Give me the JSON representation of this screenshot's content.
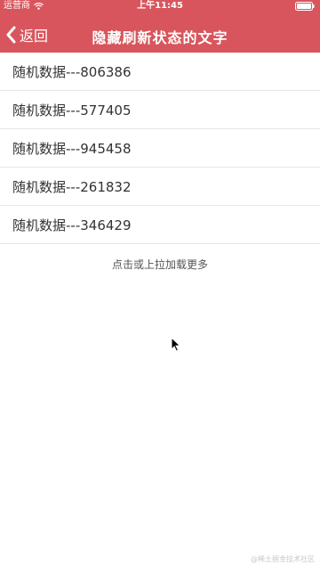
{
  "status_bar": {
    "carrier": "运营商",
    "time": "上午11:45",
    "wifi_icon": "wifi-icon",
    "battery_icon": "battery-icon"
  },
  "nav": {
    "back_label": "返回",
    "back_icon": "chevron-left-icon",
    "title": "隐藏刷新状态的文字",
    "color": "#d9555d"
  },
  "list": {
    "items": [
      {
        "label": "随机数据---806386"
      },
      {
        "label": "随机数据---577405"
      },
      {
        "label": "随机数据---945458"
      },
      {
        "label": "随机数据---261832"
      },
      {
        "label": "随机数据---346429"
      }
    ]
  },
  "footer": {
    "load_more": "点击或上拉加载更多"
  },
  "watermark": "@稀土掘金技术社区"
}
